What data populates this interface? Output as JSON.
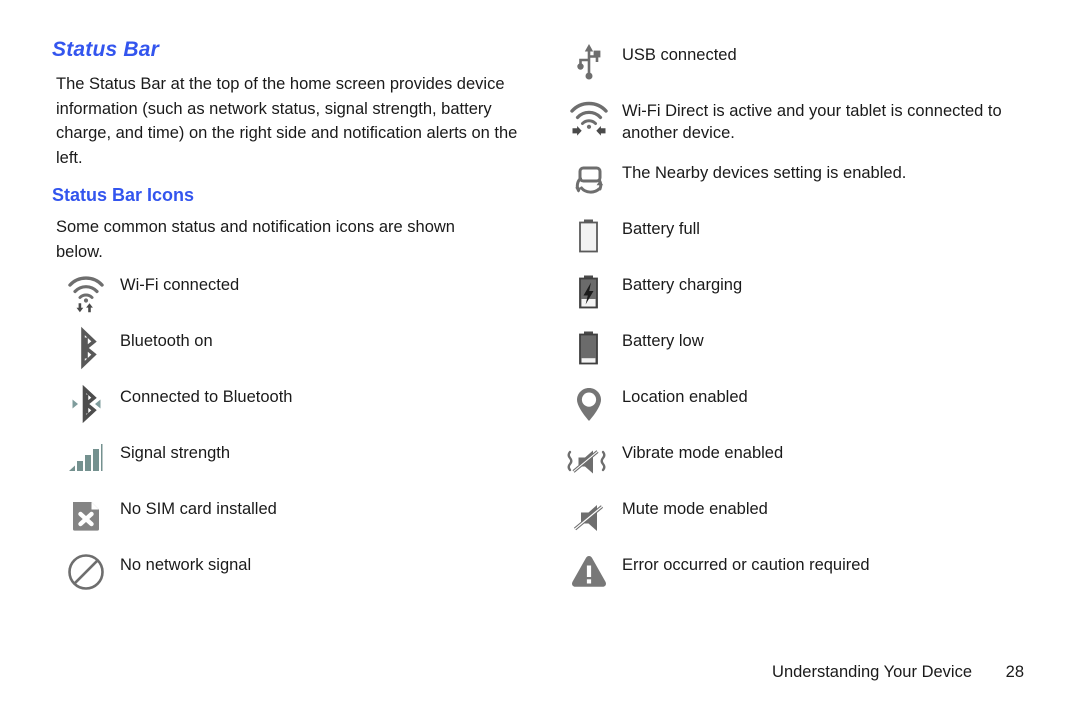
{
  "section": {
    "title": "Status Bar",
    "body": "The Status Bar at the top of the home screen provides device information (such as network status, signal strength, battery charge, and time) on the right side and notification alerts on the left.",
    "subtitle": "Status Bar Icons",
    "subbody": "Some common status and notification icons are shown below."
  },
  "colors": {
    "heading": "#3355ee",
    "text": "#1a1a1a",
    "icon_gray": "#6e6e6e",
    "icon_dark": "#3a3a3a",
    "icon_teal": "#6f8f8f",
    "page_bg": "#ffffff"
  },
  "left_column": [
    {
      "icon": "wifi-connected-icon",
      "label": "Wi-Fi connected"
    },
    {
      "icon": "bluetooth-on-icon",
      "label": "Bluetooth on"
    },
    {
      "icon": "bluetooth-connected-icon",
      "label": "Connected to Bluetooth"
    },
    {
      "icon": "signal-strength-icon",
      "label": "Signal strength"
    },
    {
      "icon": "no-sim-card-icon",
      "label": "No SIM card installed"
    },
    {
      "icon": "no-network-signal-icon",
      "label": "No network signal"
    }
  ],
  "right_column": [
    {
      "icon": "usb-connected-icon",
      "label": "USB connected"
    },
    {
      "icon": "wifi-direct-icon",
      "label": "Wi-Fi Direct is active and your tablet is connected to another device."
    },
    {
      "icon": "nearby-devices-icon",
      "label": "The Nearby devices setting is enabled."
    },
    {
      "icon": "battery-full-icon",
      "label": "Battery full"
    },
    {
      "icon": "battery-charging-icon",
      "label": "Battery charging"
    },
    {
      "icon": "battery-low-icon",
      "label": "Battery low"
    },
    {
      "icon": "location-enabled-icon",
      "label": "Location enabled"
    },
    {
      "icon": "vibrate-mode-icon",
      "label": "Vibrate mode enabled"
    },
    {
      "icon": "mute-mode-icon",
      "label": "Mute mode enabled"
    },
    {
      "icon": "error-caution-icon",
      "label": "Error occurred or caution required"
    }
  ],
  "footer": {
    "chapter": "Understanding Your Device",
    "page": "28"
  }
}
